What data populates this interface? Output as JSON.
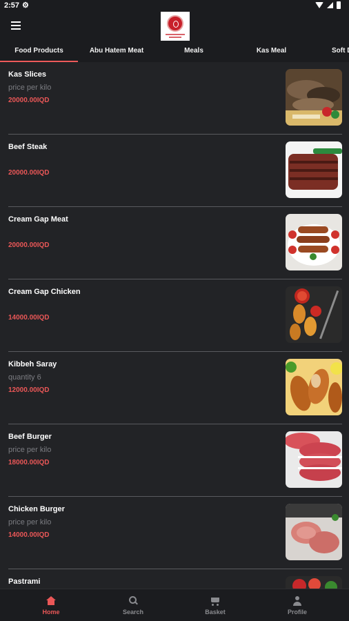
{
  "status_bar": {
    "time": "2:57"
  },
  "colors": {
    "accent": "#ea5757",
    "background": "#222326",
    "bar": "#1b1c1f"
  },
  "tabs": [
    {
      "label": "Food Products",
      "active": true
    },
    {
      "label": "Abu Hatem Meat",
      "active": false
    },
    {
      "label": "Meals",
      "active": false
    },
    {
      "label": "Kas Meal",
      "active": false
    },
    {
      "label": "Soft D",
      "active": false
    }
  ],
  "products": [
    {
      "name": "Kas Slices",
      "subtitle": "price per kilo",
      "price": "20000.00IQD",
      "image": "kas-slices-photo"
    },
    {
      "name": "Beef Steak",
      "subtitle": "",
      "price": "20000.00IQD",
      "image": "beef-steak-photo"
    },
    {
      "name": "Cream Gap Meat",
      "subtitle": "",
      "price": "20000.00IQD",
      "image": "cream-gap-meat-photo"
    },
    {
      "name": "Cream Gap Chicken",
      "subtitle": "",
      "price": "14000.00IQD",
      "image": "cream-gap-chicken-photo"
    },
    {
      "name": "Kibbeh Saray",
      "subtitle": "quantity 6",
      "price": "12000.00IQD",
      "image": "kibbeh-saray-photo"
    },
    {
      "name": "Beef Burger",
      "subtitle": "price per kilo",
      "price": "18000.00IQD",
      "image": "beef-burger-photo"
    },
    {
      "name": "Chicken Burger",
      "subtitle": "price per kilo",
      "price": "14000.00IQD",
      "image": "chicken-burger-photo"
    },
    {
      "name": "Pastrami",
      "subtitle": "",
      "price": "",
      "image": "pastrami-photo"
    }
  ],
  "bottom_nav": [
    {
      "label": "Home",
      "icon": "home-icon",
      "active": true
    },
    {
      "label": "Search",
      "icon": "search-icon",
      "active": false
    },
    {
      "label": "Basket",
      "icon": "cart-icon",
      "active": false
    },
    {
      "label": "Profile",
      "icon": "person-icon",
      "active": false
    }
  ]
}
